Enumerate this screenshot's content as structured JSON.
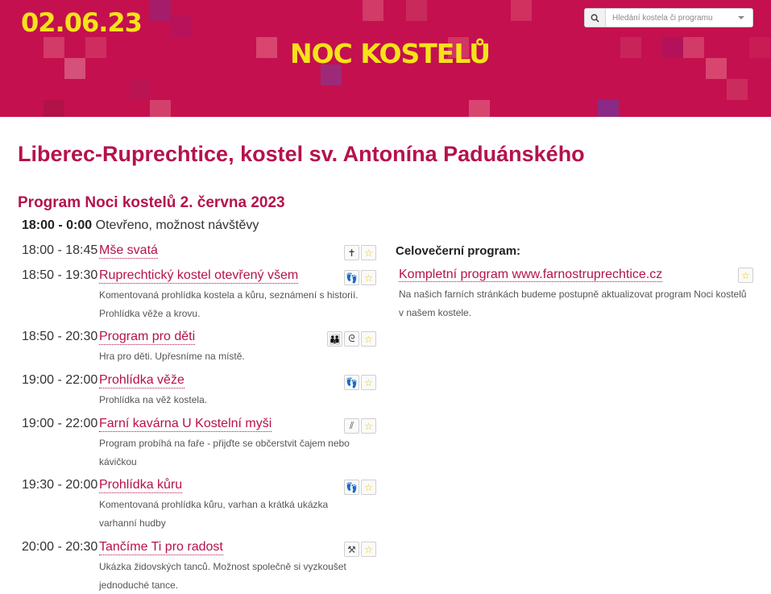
{
  "header": {
    "date": "02.06.23",
    "brand": "NOC KOSTELŮ",
    "search_placeholder": "Hledání kostela či programu",
    "colors": {
      "banner": "#c4104f",
      "logo": "#f6e31b",
      "accent": "#b5124d"
    }
  },
  "church_title": "Liberec-Ruprechtice, kostel sv. Antonína Paduánského",
  "program_title": "Program Noci kostelů 2. června 2023",
  "open_hours": {
    "time": "18:00 - 0:00",
    "text": "Otevřeno, možnost návštěvy"
  },
  "events": [
    {
      "time": "18:00 - 18:45",
      "name": "Mše svatá",
      "desc": "",
      "icons": [
        "mass-icon",
        "favorite-star-icon"
      ]
    },
    {
      "time": "18:50 - 19:30",
      "name": "Ruprechtický kostel otevřený všem",
      "desc": "Komentovaná prohlídka kostela a kůru, seznámení s historií. Prohlídka věže a krovu.",
      "icons": [
        "footsteps-icon",
        "favorite-star-icon"
      ]
    },
    {
      "time": "18:50 - 20:30",
      "name": "Program pro děti",
      "desc": "Hra pro děti. Upřesníme na místě.",
      "icons": [
        "family-icon",
        "pacifier-icon",
        "favorite-star-icon"
      ]
    },
    {
      "time": "19:00 - 22:00",
      "name": "Prohlídka věže",
      "desc": "Prohlídka na věž kostela.",
      "icons": [
        "footsteps-icon",
        "favorite-star-icon"
      ]
    },
    {
      "time": "19:00 - 22:00",
      "name": "Farní kavárna U Kostelní myši",
      "desc": "Program probíhá na faře - přijďte se občerstvit čajem nebo kávičkou",
      "icons": [
        "cutlery-icon",
        "favorite-star-icon"
      ]
    },
    {
      "time": "19:30 - 20:00",
      "name": "Prohlídka kůru",
      "desc": "Komentovaná prohlídka kůru, varhan a krátká ukázka varhanní hudby",
      "icons": [
        "footsteps-icon",
        "favorite-star-icon"
      ]
    },
    {
      "time": "20:00 - 20:30",
      "name": "Tančíme Ti pro radost",
      "desc": "Ukázka židovských tanců. Možnost společně si vyzkoušet jednoduché tance.",
      "icons": [
        "hammer-icon",
        "favorite-star-icon"
      ]
    }
  ],
  "all_night": {
    "heading": "Celovečerní program:",
    "name": "Kompletní program www.farnostruprechtice.cz",
    "desc": "Na našich farních stránkách budeme postupně aktualizovat program Noci kostelů v našem kostele.",
    "icons": [
      "favorite-star-icon"
    ]
  }
}
